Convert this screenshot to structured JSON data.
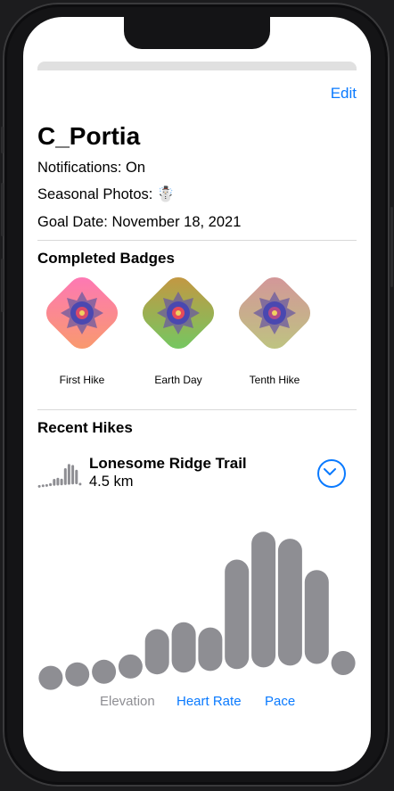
{
  "header": {
    "edit_label": "Edit"
  },
  "profile": {
    "username": "C_Portia",
    "notifications": "Notifications: On",
    "seasonal_photos": "Seasonal Photos: ☃️",
    "goal_date": "Goal Date: November 18, 2021"
  },
  "badges": {
    "title": "Completed Badges",
    "items": [
      {
        "label": "First Hike",
        "colors": [
          "#ff6fc8",
          "#f7a35a"
        ],
        "center": "#d94a6a"
      },
      {
        "label": "Earth Day",
        "colors": [
          "#d98a3a",
          "#5fd46a"
        ],
        "center": "#e64a5a"
      },
      {
        "label": "Tenth Hike",
        "colors": [
          "#d98aa0",
          "#b8d07a"
        ],
        "center": "#b04a8a"
      }
    ]
  },
  "recent_hikes": {
    "title": "Recent Hikes",
    "hike": {
      "name": "Lonesome Ridge Trail",
      "distance": "4.5 km"
    }
  },
  "chart_data": {
    "type": "bar",
    "selected_metric": "Elevation",
    "color": "#8e8e93",
    "series": [
      {
        "values": [
          [
            0,
            4
          ],
          [
            1,
            7
          ],
          [
            2,
            9
          ],
          [
            3,
            14
          ],
          [
            4,
            30
          ],
          [
            5,
            34
          ],
          [
            6,
            31
          ],
          [
            7,
            70
          ],
          [
            8,
            86
          ],
          [
            9,
            82
          ],
          [
            10,
            64
          ],
          [
            11,
            10
          ]
        ]
      }
    ],
    "ylim": [
      0,
      100
    ]
  },
  "tabs": {
    "elevation": "Elevation",
    "heart_rate": "Heart Rate",
    "pace": "Pace"
  }
}
